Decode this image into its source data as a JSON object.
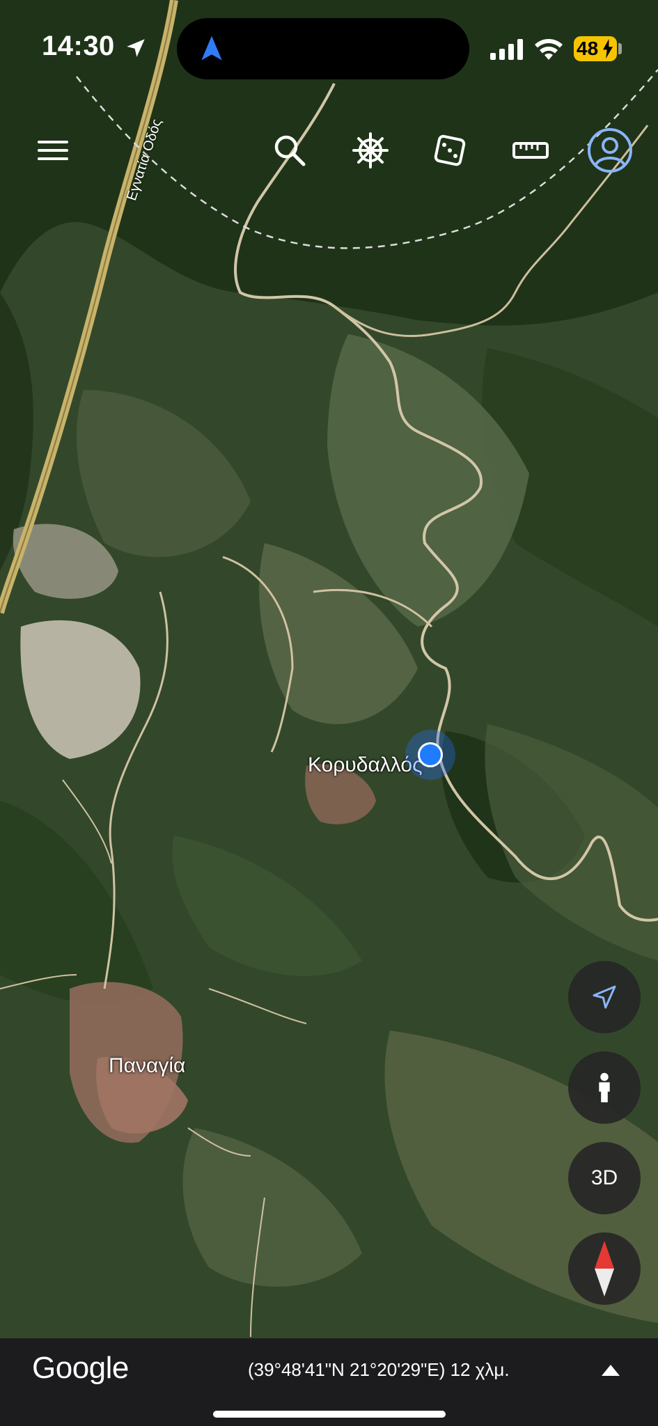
{
  "status_bar": {
    "time": "14:30",
    "battery": "48",
    "icons": [
      "location-arrow-icon",
      "signal-icon",
      "wifi-icon",
      "battery-charging-icon"
    ]
  },
  "toolbar": {
    "icons": [
      "menu-icon",
      "search-icon",
      "voyager-wheel-icon",
      "dice-icon",
      "ruler-icon",
      "account-icon"
    ]
  },
  "map": {
    "mode": "satellite",
    "road_label": "Εγνατία Οδός",
    "places": [
      {
        "name": "Κορυδαλλός"
      },
      {
        "name": "Παναγία"
      }
    ]
  },
  "controls": {
    "my_location_icon": "my-location-icon",
    "street_view_icon": "pegman-icon",
    "view_3d_label": "3D",
    "compass_icon": "compass-icon"
  },
  "footer": {
    "logo": "Google",
    "coordinates": "(39°48'41\"N 21°20'29\"E) 12 χλμ.",
    "expand_icon": "caret-up-icon"
  },
  "colors": {
    "location_blue": "#1f7bff",
    "battery_yellow": "#f5c400",
    "bottom_bar": "#1c1c1e"
  }
}
